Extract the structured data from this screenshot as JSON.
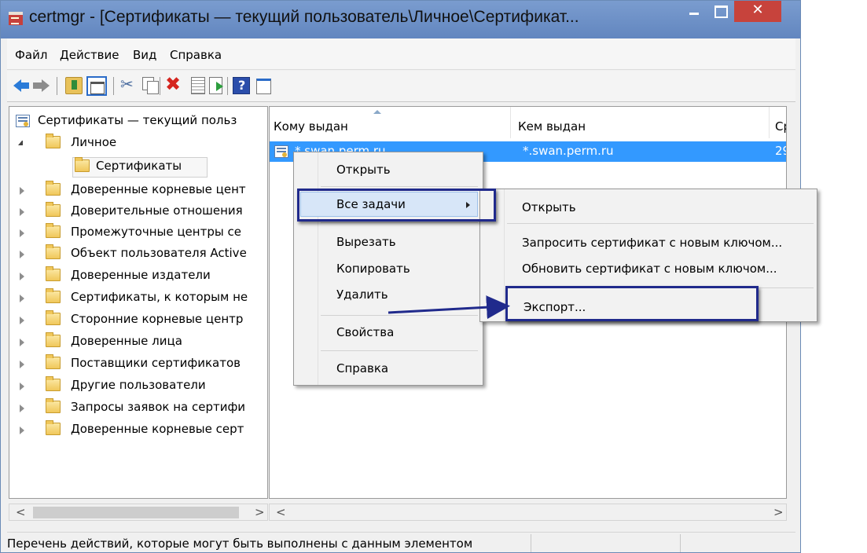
{
  "window": {
    "title": "certmgr - [Сертификаты — текущий пользователь\\Личное\\Сертификат...",
    "close_glyph": "✕"
  },
  "menubar": [
    "Файл",
    "Действие",
    "Вид",
    "Справка"
  ],
  "toolbar_icons": [
    "back-arrow-icon",
    "forward-arrow-icon",
    "up-folder-icon",
    "show-console-tree-icon",
    "cut-icon",
    "copy-icon",
    "delete-icon",
    "properties-icon",
    "export-list-icon",
    "help-icon",
    "action-pane-icon"
  ],
  "tree": {
    "root": "Сертификаты — текущий польз",
    "items": [
      "Личное",
      "Сертификаты",
      "Доверенные корневые цент",
      "Доверительные отношения",
      "Промежуточные центры се",
      "Объект пользователя Active",
      "Доверенные издатели",
      "Сертификаты, к которым не",
      "Сторонние корневые центр",
      "Доверенные лица",
      "Поставщики сертификатов",
      "Другие пользователи",
      "Запросы заявок на сертифи",
      "Доверенные корневые серт"
    ]
  },
  "list": {
    "columns": [
      "Кому выдан",
      "Кем выдан",
      "Ср"
    ],
    "rows": [
      {
        "issued_to": "*.swan.perm.ru",
        "issued_by": "*.swan.perm.ru",
        "expires": "29"
      }
    ]
  },
  "context_menu": {
    "items": [
      "Открыть",
      "Все задачи",
      "Вырезать",
      "Копировать",
      "Удалить",
      "Свойства",
      "Справка"
    ]
  },
  "submenu": {
    "items": [
      "Открыть",
      "Запросить сертификат с новым ключом...",
      "Обновить сертификат с новым ключом...",
      "Экспорт..."
    ]
  },
  "scroll": {
    "left_arrow": "<",
    "right_arrow": ">"
  },
  "status": {
    "text": "Перечень действий, которые могут быть выполнены с данным элементом"
  },
  "colors": {
    "selection": "#3399ff",
    "titlebar": "#6b8fc7",
    "callout": "#202a8c",
    "close": "#c7433c"
  }
}
